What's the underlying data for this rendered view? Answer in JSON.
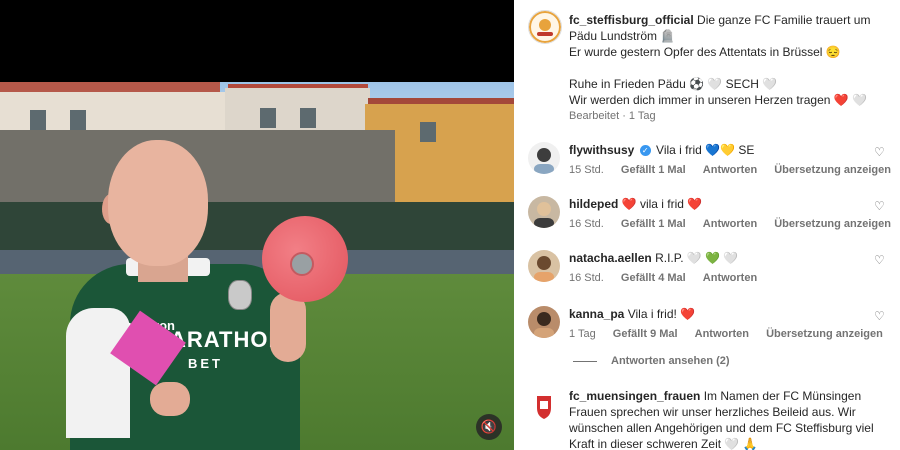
{
  "media": {
    "shirt_brand": "macron",
    "shirt_sponsor": "ARATHON",
    "shirt_sponsor2": "BET",
    "mute_icon": "muted-speaker-icon"
  },
  "caption": {
    "username": "fc_steffisburg_official",
    "line1": "Die ganze FC Familie trauert um Pädu Lundström 🪦",
    "line2": "Er wurde gestern Opfer des Attentats in Brüssel 😔",
    "line3": "Ruhe in Frieden Pädu ⚽ 🤍 SECH 🤍",
    "line4": "Wir werden dich immer in unseren Herzen tragen ❤️ 🤍",
    "meta": "Bearbeitet · 1 Tag"
  },
  "comments": [
    {
      "username": "flywithsusy",
      "verified": true,
      "text": "Vila i frid 💙💛 SE",
      "time": "15 Std.",
      "likes": "Gefällt 1 Mal",
      "reply": "Antworten",
      "translate": "Übersetzung anzeigen"
    },
    {
      "username": "hildeped",
      "verified": false,
      "text": "❤️ vila i frid ❤️",
      "time": "16 Std.",
      "likes": "Gefällt 1 Mal",
      "reply": "Antworten",
      "translate": "Übersetzung anzeigen"
    },
    {
      "username": "natacha.aellen",
      "verified": false,
      "text": "R.I.P. 🤍 💚 🤍",
      "time": "16 Std.",
      "likes": "Gefällt 4 Mal",
      "reply": "Antworten",
      "translate": ""
    },
    {
      "username": "kanna_pa",
      "verified": false,
      "text": "Vila i frid! ❤️",
      "time": "1 Tag",
      "likes": "Gefällt 9 Mal",
      "reply": "Antworten",
      "translate": "Übersetzung anzeigen"
    },
    {
      "username": "fc_muensingen_frauen",
      "verified": false,
      "text": "Im Namen der FC Münsingen Frauen sprechen wir unser herzliches Beileid aus. Wir wünschen allen Angehörigen und dem FC Steffisburg viel Kraft in dieser schweren Zeit 🤍 🙏",
      "time": "",
      "likes": "",
      "reply": "",
      "translate": ""
    }
  ],
  "view_replies": "Antworten ansehen (2)",
  "colors": {
    "text": "#262626",
    "meta": "#737373",
    "verified": "#3897f0",
    "shirt": "#1b5638"
  }
}
